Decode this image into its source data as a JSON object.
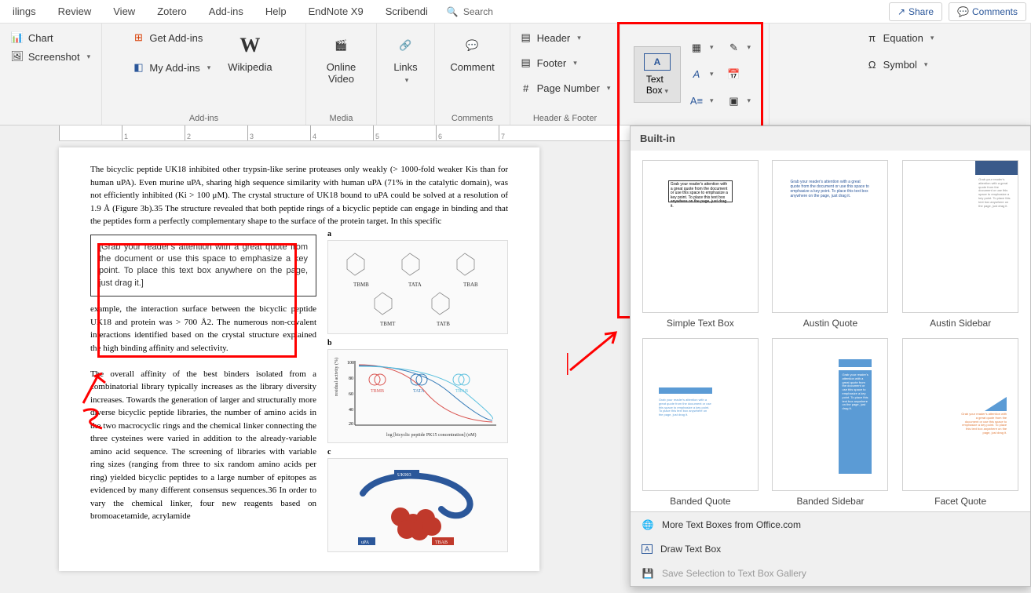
{
  "tabs": [
    "ilings",
    "Review",
    "View",
    "Zotero",
    "Add-ins",
    "Help",
    "EndNote X9",
    "Scribendi"
  ],
  "search_placeholder": "Search",
  "share": "Share",
  "comments": "Comments",
  "ribbon": {
    "chart": "Chart",
    "screenshot": "Screenshot",
    "get_addins": "Get Add-ins",
    "my_addins": "My Add-ins",
    "wikipedia": "Wikipedia",
    "online_video": "Online\nVideo",
    "links": "Links",
    "comment": "Comment",
    "header": "Header",
    "footer": "Footer",
    "page_number": "Page Number",
    "text_box": "Text\nBox",
    "equation": "Equation",
    "symbol": "Symbol",
    "groups": {
      "addins": "Add-ins",
      "media": "Media",
      "comments_g": "Comments",
      "header_footer": "Header & Footer"
    }
  },
  "textbox_panel": {
    "header": "Built-in",
    "items": [
      "Simple Text Box",
      "Austin Quote",
      "Austin Sidebar",
      "Banded Quote",
      "Banded Sidebar",
      "Facet Quote"
    ],
    "sample": "Grab your reader's attention with a great quote from the document or use this space to emphasize a key point. To place this text box anywhere on the page, just drag it.",
    "footer": {
      "more": "More Text Boxes from Office.com",
      "draw": "Draw Text Box",
      "save": "Save Selection to Text Box Gallery"
    }
  },
  "doc": {
    "para1": "The bicyclic peptide UK18 inhibited other trypsin-like serine proteases only weakly (> 1000-fold weaker Kis than for human uPA). Even murine uPA, sharing high sequence similarity with human uPA (71% in the catalytic domain), was not efficiently inhibited (Ki > 100 μM). The crystal structure of UK18 bound to uPA could be solved at a resolution of 1.9 Å (Figure 3b).35 The structure revealed that both peptide rings of a bicyclic peptide can engage in binding and that the peptides form a perfectly complementary shape to the surface of the protein target. In this specific",
    "quote": "[Grab your reader's attention with a great quote from the document or use this space to emphasize a key point. To place this text box anywhere on the page, just drag it.]",
    "para2": "example, the interaction surface between the bicyclic peptide UK18 and protein was > 700 Å2. The numerous non-covalent interactions identified based on the crystal structure explained the high binding affinity and selectivity.",
    "para3": "The overall affinity of the best binders isolated from a combinatorial library typically increases as the library diversity increases. Towards the generation of larger and structurally more diverse bicyclic peptide libraries, the number of amino acids in the two macrocyclic rings and the chemical linker connecting the three cysteines were varied in addition to the already-variable amino acid sequence. The screening of libraries with variable ring sizes (ranging from three to six random amino acids per ring) yielded bicyclic peptides to a large number of epitopes as evidenced by many different consensus sequences.36 In order to vary the chemical linker, four new reagents based on bromoacetamide, acrylamide",
    "fig_labels": [
      "TBMB",
      "TATA",
      "TBAB",
      "TBMT",
      "TATB"
    ],
    "chart_axis_x": "log [bicyclic peptide PK15 concentration] (nM)",
    "chart_axis_y": "residual activity (%)",
    "fig_c_labels": [
      "UK903",
      "uPA",
      "TBAB"
    ]
  },
  "ruler_ticks": [
    "",
    "1",
    "2",
    "3",
    "4",
    "5",
    "6",
    "7"
  ]
}
